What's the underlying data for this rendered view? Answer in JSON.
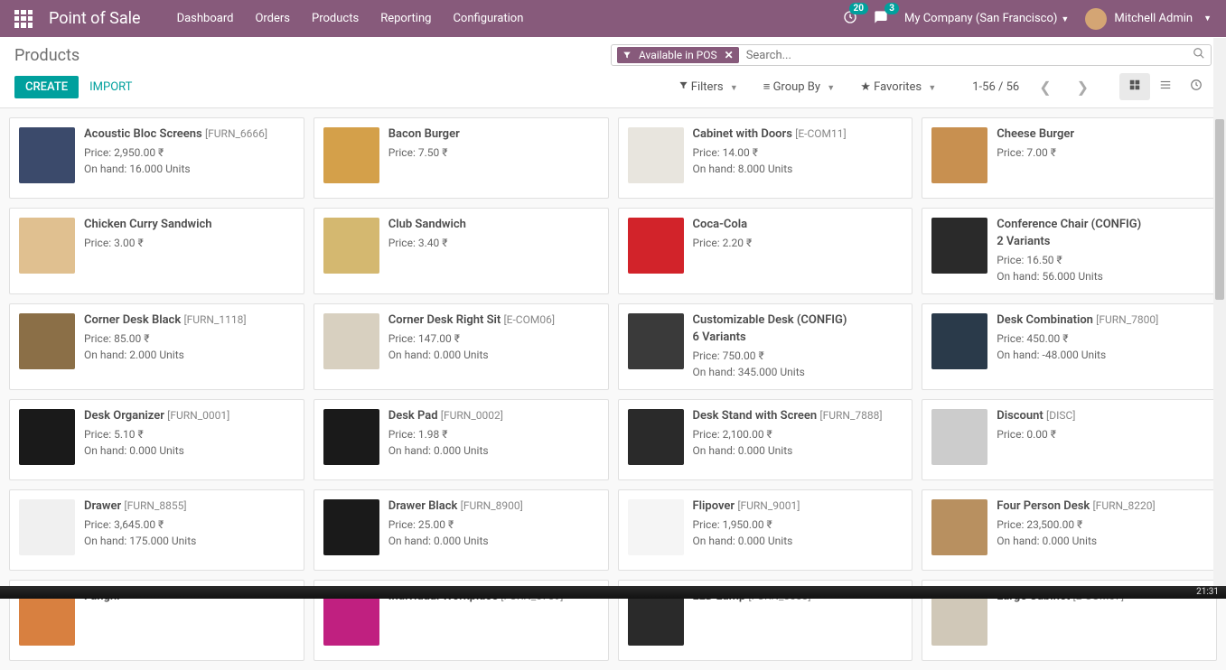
{
  "navbar": {
    "app_title": "Point of Sale",
    "menu": [
      "Dashboard",
      "Orders",
      "Products",
      "Reporting",
      "Configuration"
    ],
    "notif_activity": "20",
    "notif_msg": "3",
    "company": "My Company (San Francisco)",
    "user": "Mitchell Admin"
  },
  "control_panel": {
    "breadcrumb": "Products",
    "facet": "Available in POS",
    "search_placeholder": "Search...",
    "create": "CREATE",
    "import": "IMPORT",
    "filters_label": "Filters",
    "groupby_label": "Group By",
    "favorites_label": "Favorites",
    "pager": "1-56 / 56"
  },
  "products": [
    {
      "name": "Acoustic Bloc Screens",
      "code": "[FURN_6666]",
      "price": "Price: 2,950.00 ₹",
      "onhand": "On hand: 16.000 Units",
      "img": "#3b4a6b"
    },
    {
      "name": "Bacon Burger",
      "code": "",
      "price": "Price: 7.50 ₹",
      "onhand": "",
      "img": "#d4a04a"
    },
    {
      "name": "Cabinet with Doors",
      "code": "[E-COM11]",
      "price": "Price: 14.00 ₹",
      "onhand": "On hand: 8.000 Units",
      "img": "#e8e5de"
    },
    {
      "name": "Cheese Burger",
      "code": "",
      "price": "Price: 7.00 ₹",
      "onhand": "",
      "img": "#c89050"
    },
    {
      "name": "Chicken Curry Sandwich",
      "code": "",
      "price": "Price: 3.00 ₹",
      "onhand": "",
      "img": "#e0c090"
    },
    {
      "name": "Club Sandwich",
      "code": "",
      "price": "Price: 3.40 ₹",
      "onhand": "",
      "img": "#d4b870"
    },
    {
      "name": "Coca-Cola",
      "code": "",
      "price": "Price: 2.20 ₹",
      "onhand": "",
      "img": "#d2232a"
    },
    {
      "name": "Conference Chair (CONFIG)",
      "code": "",
      "variants": "2 Variants",
      "price": "Price: 16.50 ₹",
      "onhand": "On hand: 56.000 Units",
      "img": "#2a2a2a"
    },
    {
      "name": "Corner Desk Black",
      "code": "[FURN_1118]",
      "price": "Price: 85.00 ₹",
      "onhand": "On hand: 2.000 Units",
      "img": "#8b6f47"
    },
    {
      "name": "Corner Desk Right Sit",
      "code": "[E-COM06]",
      "price": "Price: 147.00 ₹",
      "onhand": "On hand: 0.000 Units",
      "img": "#d8d0c0"
    },
    {
      "name": "Customizable Desk (CONFIG)",
      "code": "",
      "variants": "6 Variants",
      "price": "Price: 750.00 ₹",
      "onhand": "On hand: 345.000 Units",
      "img": "#3a3a3a"
    },
    {
      "name": "Desk Combination",
      "code": "[FURN_7800]",
      "price": "Price: 450.00 ₹",
      "onhand": "On hand: -48.000 Units",
      "img": "#2a3a4a"
    },
    {
      "name": "Desk Organizer",
      "code": "[FURN_0001]",
      "price": "Price: 5.10 ₹",
      "onhand": "On hand: 0.000 Units",
      "img": "#1a1a1a"
    },
    {
      "name": "Desk Pad",
      "code": "[FURN_0002]",
      "price": "Price: 1.98 ₹",
      "onhand": "On hand: 0.000 Units",
      "img": "#1a1a1a"
    },
    {
      "name": "Desk Stand with Screen",
      "code": "[FURN_7888]",
      "price": "Price: 2,100.00 ₹",
      "onhand": "On hand: 0.000 Units",
      "img": "#2a2a2a"
    },
    {
      "name": "Discount",
      "code": "[DISC]",
      "price": "Price: 0.00 ₹",
      "onhand": "",
      "img": "#cccccc"
    },
    {
      "name": "Drawer",
      "code": "[FURN_8855]",
      "price": "Price: 3,645.00 ₹",
      "onhand": "On hand: 175.000 Units",
      "img": "#f0f0f0"
    },
    {
      "name": "Drawer Black",
      "code": "[FURN_8900]",
      "price": "Price: 25.00 ₹",
      "onhand": "On hand: 0.000 Units",
      "img": "#1a1a1a"
    },
    {
      "name": "Flipover",
      "code": "[FURN_9001]",
      "price": "Price: 1,950.00 ₹",
      "onhand": "On hand: 0.000 Units",
      "img": "#f5f5f5"
    },
    {
      "name": "Four Person Desk",
      "code": "[FURN_8220]",
      "price": "Price: 23,500.00 ₹",
      "onhand": "On hand: 0.000 Units",
      "img": "#b89060"
    },
    {
      "name": "Funghi",
      "code": "",
      "price": "",
      "onhand": "",
      "img": "#d88040"
    },
    {
      "name": "Individual Workplace",
      "code": "[FURN_0789]",
      "price": "",
      "onhand": "",
      "img": "#c02080"
    },
    {
      "name": "LED Lamp",
      "code": "[FURN_0003]",
      "price": "",
      "onhand": "",
      "img": "#2a2a2a"
    },
    {
      "name": "Large Cabinet",
      "code": "[E-COM07]",
      "price": "",
      "onhand": "",
      "img": "#d0c8b8"
    }
  ],
  "taskbar": {
    "clock": "21:31"
  }
}
